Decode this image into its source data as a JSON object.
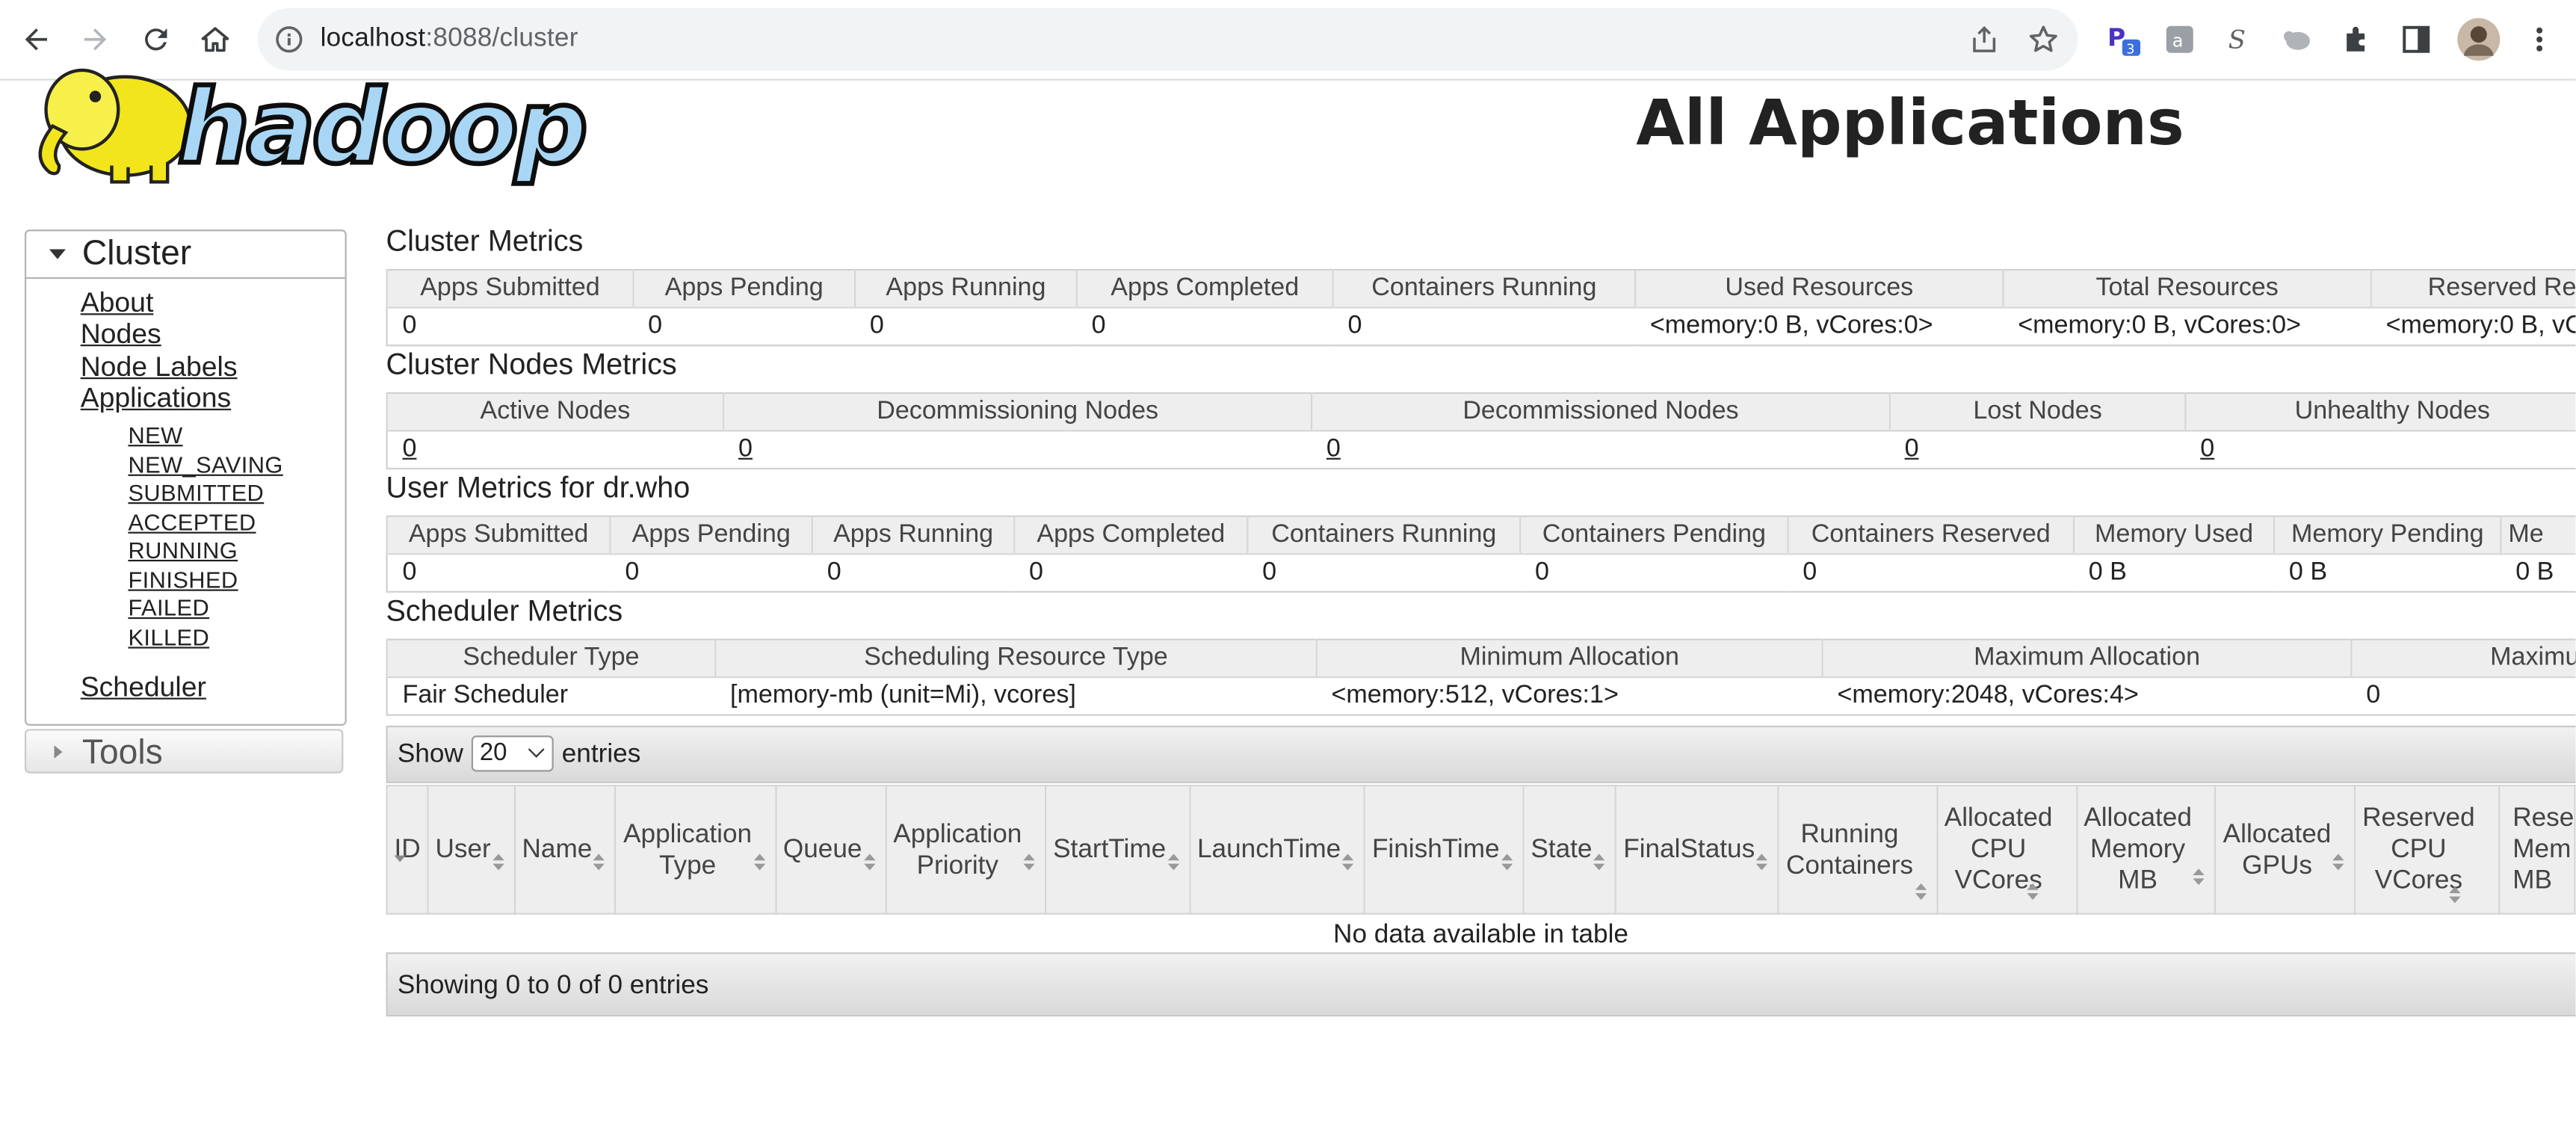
{
  "browser": {
    "url_host": "localhost",
    "url_path": ":8088/cluster"
  },
  "logo_text": "hadoop",
  "page_title": "All Applications",
  "sidebar": {
    "cluster_header": "Cluster",
    "links": [
      "About",
      "Nodes",
      "Node Labels",
      "Applications"
    ],
    "app_states": [
      "NEW",
      "NEW_SAVING",
      "SUBMITTED",
      "ACCEPTED",
      "RUNNING",
      "FINISHED",
      "FAILED",
      "KILLED"
    ],
    "scheduler_link": "Scheduler",
    "tools_header": "Tools"
  },
  "cluster_metrics": {
    "title": "Cluster Metrics",
    "headers": [
      "Apps Submitted",
      "Apps Pending",
      "Apps Running",
      "Apps Completed",
      "Containers Running",
      "Used Resources",
      "Total Resources",
      "Reserved Re"
    ],
    "values": [
      "0",
      "0",
      "0",
      "0",
      "0",
      "<memory:0 B, vCores:0>",
      "<memory:0 B, vCores:0>",
      "<memory:0 B, vC"
    ]
  },
  "cluster_nodes_metrics": {
    "title": "Cluster Nodes Metrics",
    "headers": [
      "Active Nodes",
      "Decommissioning Nodes",
      "Decommissioned Nodes",
      "Lost Nodes",
      "Unhealthy Nodes"
    ],
    "values": [
      "0",
      "0",
      "0",
      "0",
      "0"
    ]
  },
  "user_metrics": {
    "title": "User Metrics for dr.who",
    "headers": [
      "Apps Submitted",
      "Apps Pending",
      "Apps Running",
      "Apps Completed",
      "Containers Running",
      "Containers Pending",
      "Containers Reserved",
      "Memory Used",
      "Memory Pending",
      "Me"
    ],
    "values": [
      "0",
      "0",
      "0",
      "0",
      "0",
      "0",
      "0",
      "0 B",
      "0 B",
      "0 B"
    ]
  },
  "scheduler_metrics": {
    "title": "Scheduler Metrics",
    "headers": [
      "Scheduler Type",
      "Scheduling Resource Type",
      "Minimum Allocation",
      "Maximum Allocation",
      "Maximu"
    ],
    "values": [
      "Fair Scheduler",
      "[memory-mb (unit=Mi), vcores]",
      "<memory:512, vCores:1>",
      "<memory:2048, vCores:4>",
      "0"
    ]
  },
  "datatable": {
    "show_label": "Show",
    "page_size": "20",
    "entries_label": "entries",
    "columns": [
      "ID",
      "User",
      "Name",
      "Application Type",
      "Queue",
      "Application Priority",
      "StartTime",
      "LaunchTime",
      "FinishTime",
      "State",
      "FinalStatus",
      "Running Containers",
      "Allocated CPU VCores",
      "Allocated Memory MB",
      "Allocated GPUs",
      "Reserved CPU VCores",
      "Rese Mem MB"
    ],
    "empty_message": "No data available in table",
    "footer_info": "Showing 0 to 0 of 0 entries"
  },
  "colors": {
    "header_bg": "#eeeeee",
    "toolbar_gradient_top": "#f1f1f1",
    "toolbar_gradient_bottom": "#d9d9d9",
    "border": "#d0d0d0",
    "logo_yellow": "#f2e51c",
    "logo_blue": "#a9d6f5"
  }
}
